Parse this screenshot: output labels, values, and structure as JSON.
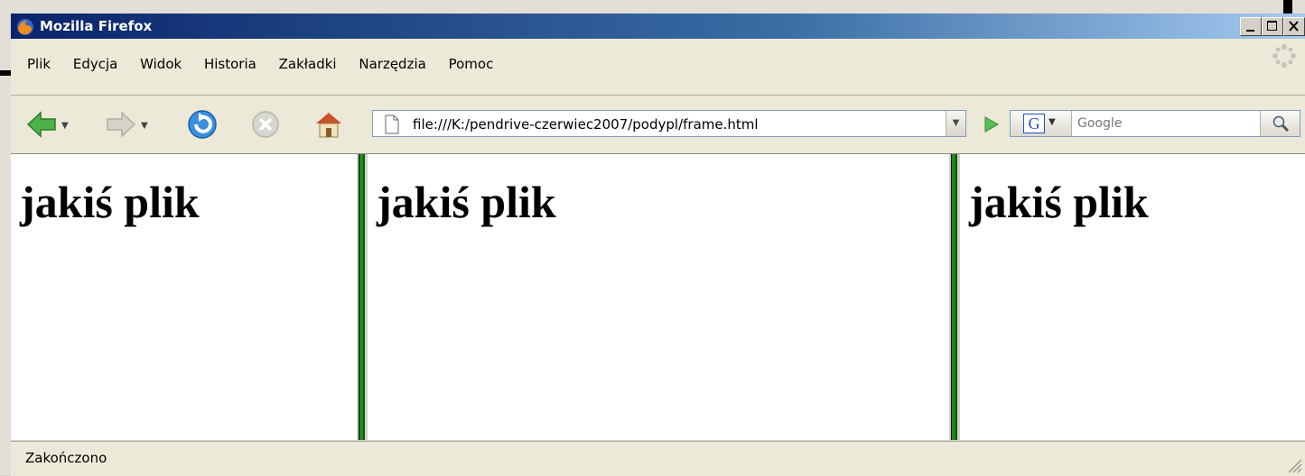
{
  "window": {
    "title": "Mozilla Firefox",
    "icon": "firefox-icon"
  },
  "menubar": {
    "items": [
      {
        "label": "Plik"
      },
      {
        "label": "Edycja"
      },
      {
        "label": "Widok"
      },
      {
        "label": "Historia"
      },
      {
        "label": "Zakładki"
      },
      {
        "label": "Narzędzia"
      },
      {
        "label": "Pomoc"
      }
    ]
  },
  "toolbar": {
    "url": "file:///K:/pendrive-czerwiec2007/podypl/frame.html",
    "search_placeholder": "Google",
    "icons": [
      "back-icon",
      "forward-icon",
      "reload-icon",
      "stop-icon",
      "home-icon",
      "page-icon",
      "go-icon",
      "google-icon",
      "search-icon"
    ]
  },
  "frames": [
    {
      "heading": "jakiś plik"
    },
    {
      "heading": "jakiś plik"
    },
    {
      "heading": "jakiś plik"
    }
  ],
  "status": {
    "text": "Zakończono"
  },
  "colors": {
    "titlebar": "#0a246a",
    "divider": "#1b8a1b",
    "chrome": "#ece9d8"
  }
}
